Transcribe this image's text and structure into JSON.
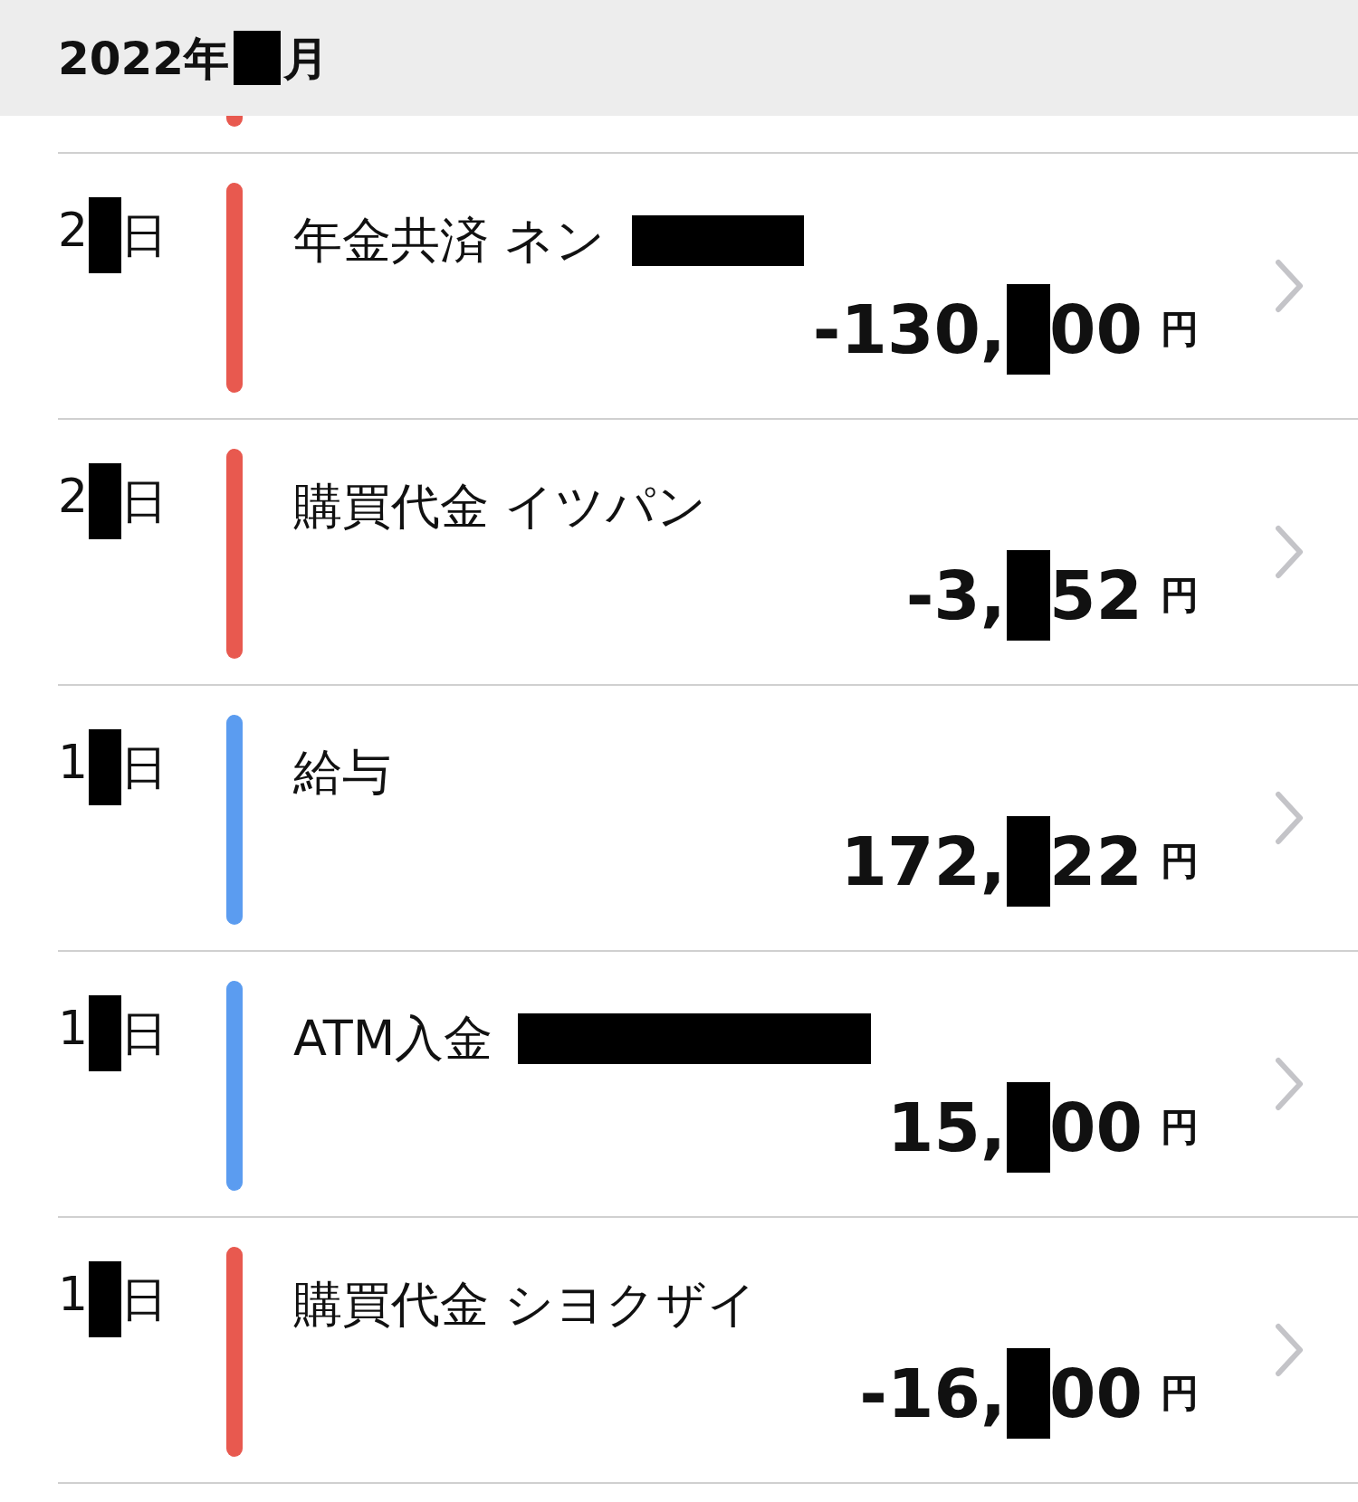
{
  "header": {
    "year": "2022年",
    "month_suffix": "月"
  },
  "partial_row": {
    "color": "#e8594f"
  },
  "transactions": [
    {
      "day_prefix": "2",
      "day_suffix": "日",
      "color": "#e8594f",
      "title": "年金共済 ネン",
      "kind": "masked",
      "amount_prefix": "-130,",
      "amount_suffix": "00",
      "currency": "円"
    },
    {
      "day_prefix": "2",
      "day_suffix": "日",
      "color": "#e8594f",
      "title": "購買代金 イツパン",
      "kind": "plain",
      "amount_prefix": "-3,",
      "amount_suffix": "52",
      "currency": "円"
    },
    {
      "day_prefix": "1",
      "day_suffix": "日",
      "color": "#5b9cf0",
      "title": "給与",
      "kind": "plain",
      "amount_prefix": "172,",
      "amount_suffix": "22",
      "currency": "円"
    },
    {
      "day_prefix": "1",
      "day_suffix": "日",
      "color": "#5b9cf0",
      "title": "ATM入金",
      "kind": "wide",
      "amount_prefix": "15,",
      "amount_suffix": "00",
      "currency": "円"
    },
    {
      "day_prefix": "1",
      "day_suffix": "日",
      "color": "#e8594f",
      "title": "購買代金 シヨクザイ",
      "kind": "plain",
      "amount_prefix": "-16,",
      "amount_suffix": "00",
      "currency": "円"
    }
  ]
}
